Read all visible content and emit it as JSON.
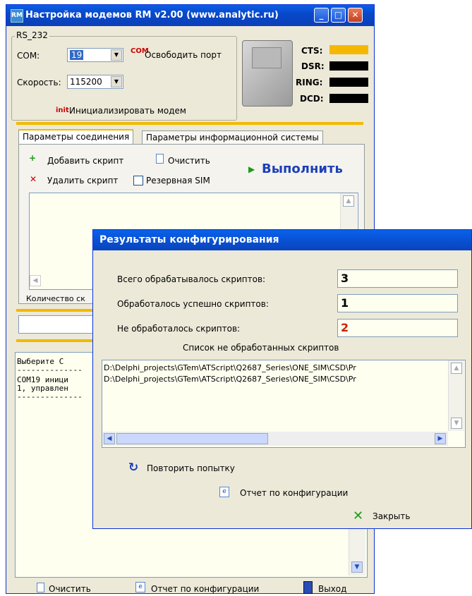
{
  "main_window": {
    "title": "Настройка модемов RM v2.00 (www.analytic.ru)",
    "title_icon": "RM",
    "minimize": "_",
    "maximize": "□",
    "close": "✕",
    "rs232": {
      "group_label": "RS_232",
      "com_label": "COM:",
      "com_value": "19",
      "release_port_icon": "COM",
      "release_port_label": "Освободить порт",
      "speed_label": "Скорость:",
      "speed_value": "115200",
      "init_icon": "init",
      "init_label": "Инициализировать модем"
    },
    "signals": [
      {
        "name": "CTS:",
        "color": "#f5b800"
      },
      {
        "name": "DSR:",
        "color": "#000000"
      },
      {
        "name": "RING:",
        "color": "#000000"
      },
      {
        "name": "DCD:",
        "color": "#000000"
      }
    ],
    "tabs": [
      {
        "label": "Параметры соединения",
        "active": true
      },
      {
        "label": "Параметры информационной системы",
        "active": false
      }
    ],
    "actions": {
      "add_script": "Добавить скрипт",
      "clear": "Очистить",
      "execute": "Выполнить",
      "delete_script": "Удалить скрипт",
      "reserve_sim": "Резервная SIM"
    },
    "count_label": "Количество ск",
    "log_lines": [
      "Выберите С",
      "--------------",
      "COM19 иници",
      "1, управлен",
      "--------------"
    ],
    "bottom": {
      "clear": "Очистить",
      "report": "Отчет по конфигурации",
      "exit": "Выход"
    }
  },
  "dialog": {
    "title": "Результаты конфигурирования",
    "total_label": "Всего обрабатывалось скриптов:",
    "total_value": "3",
    "success_label": "Обработалось успешно скриптов:",
    "success_value": "1",
    "failed_label": "Не обработалось  скриптов:",
    "failed_value": "2",
    "failed_color": "#cc2200",
    "list_title": "Список не обработанных скриптов",
    "list_items": [
      "D:\\Delphi_projects\\GTem\\ATScript\\Q2687_Series\\ONE_SIM\\CSD\\Pr",
      "D:\\Delphi_projects\\GTem\\ATScript\\Q2687_Series\\ONE_SIM\\CSD\\Pr"
    ],
    "retry": "Повторить попытку",
    "report": "Отчет по конфигурации",
    "close": "Закрыть"
  }
}
